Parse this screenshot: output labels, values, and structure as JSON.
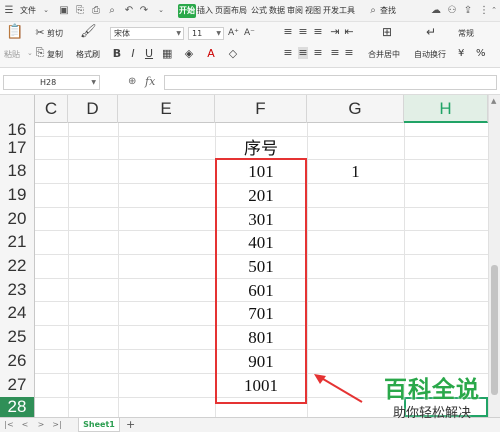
{
  "menubar": {
    "file": "文件",
    "tabs": [
      "开始",
      "插入",
      "页面布局",
      "公式",
      "数据",
      "审阅",
      "视图",
      "开发工具"
    ],
    "search": "查找"
  },
  "ribbon": {
    "paste": "粘贴",
    "cut": "剪切",
    "copy": "复制",
    "format_painter": "格式刷",
    "font_name": "宋体",
    "font_size": "11",
    "merge_center": "合并居中",
    "wrap_text": "自动换行",
    "number_format": "常规",
    "currency": "¥",
    "percent": "%"
  },
  "formula_bar": {
    "name_box": "H28",
    "fx": "fx",
    "formula": ""
  },
  "columns": [
    "C",
    "D",
    "E",
    "F",
    "G",
    "H"
  ],
  "rows": [
    "16",
    "17",
    "18",
    "19",
    "20",
    "21",
    "22",
    "23",
    "24",
    "25",
    "26",
    "27",
    "28"
  ],
  "cells": {
    "F17": "序号",
    "F18": "101",
    "F19": "201",
    "F20": "301",
    "F21": "401",
    "F22": "501",
    "F23": "601",
    "F24": "701",
    "F25": "801",
    "F26": "901",
    "F27": "1001",
    "G18": "1"
  },
  "sheet": {
    "tab": "Sheet1",
    "add": "+"
  },
  "watermark": {
    "title": "百科全说",
    "subtitle": "助你轻松解决"
  },
  "colors": {
    "accent": "#21a366",
    "highlight_box": "#e53333"
  }
}
